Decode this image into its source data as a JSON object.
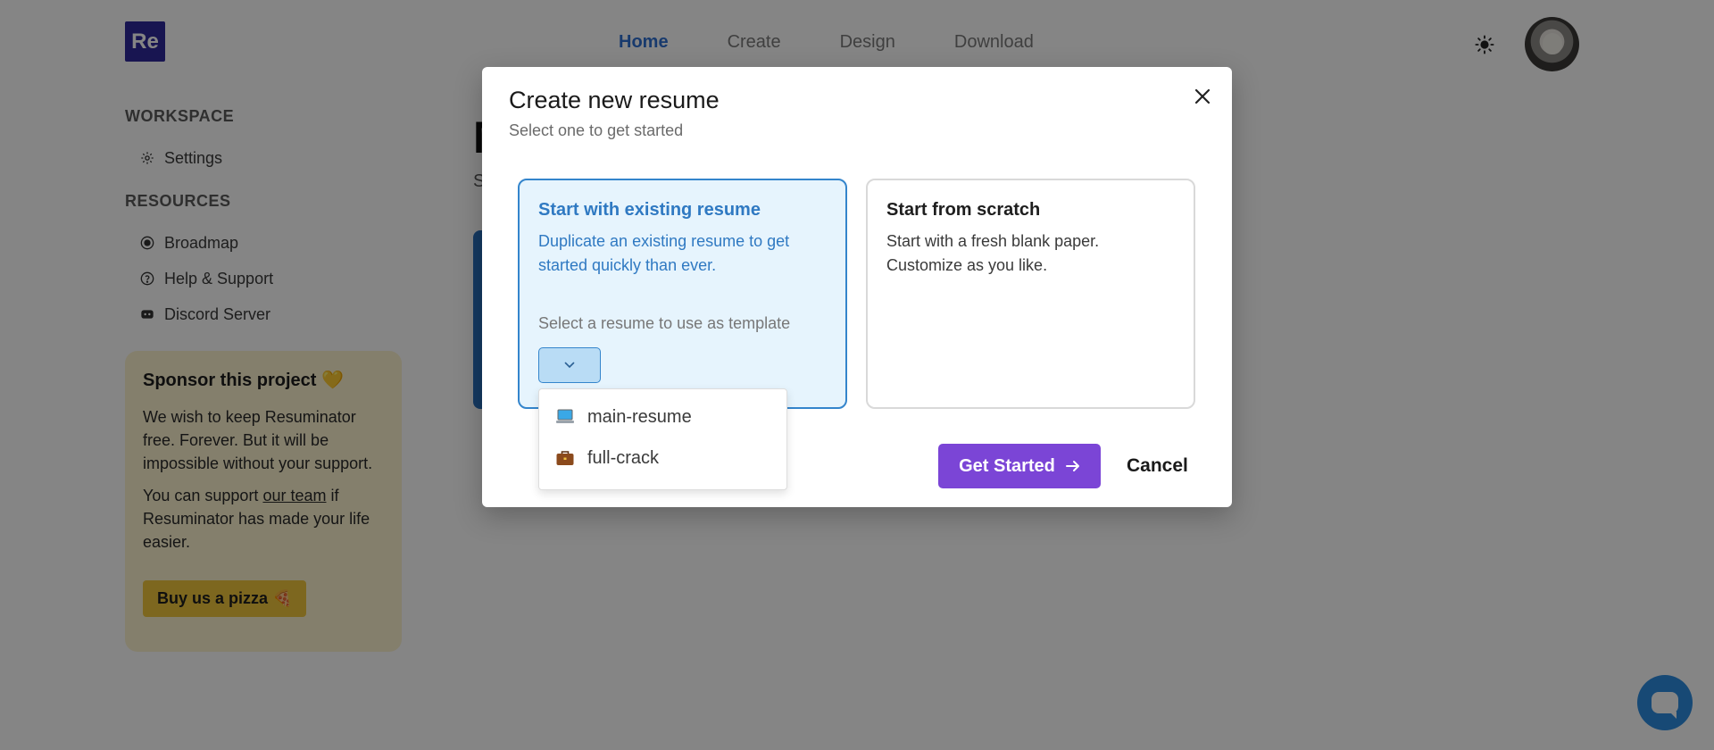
{
  "header": {
    "logo_text": "Re",
    "nav": [
      {
        "label": "Home",
        "active": true
      },
      {
        "label": "Create",
        "active": false
      },
      {
        "label": "Design",
        "active": false
      },
      {
        "label": "Download",
        "active": false
      }
    ],
    "theme_icon": "sun-icon",
    "avatar_icon": "cat-avatar"
  },
  "sidebar": {
    "workspace_heading": "WORKSPACE",
    "workspace_items": [
      {
        "label": "Settings",
        "icon": "gear-icon"
      }
    ],
    "resources_heading": "RESOURCES",
    "resources_items": [
      {
        "label": "Broadmap",
        "icon": "radio-icon"
      },
      {
        "label": "Help & Support",
        "icon": "help-icon"
      },
      {
        "label": "Discord Server",
        "icon": "discord-icon"
      }
    ]
  },
  "sponsor": {
    "title": "Sponsor this project 💛",
    "paragraph1": "We wish to keep Resuminator free. Forever. But it will be impossible without your support.",
    "paragraph2_prefix": "You can support ",
    "paragraph2_link": "our team",
    "paragraph2_suffix": " if Resuminator has made your life easier.",
    "button_label": "Buy us a pizza 🍕"
  },
  "modal": {
    "title": "Create new resume",
    "subtitle": "Select one to get started",
    "option_existing": {
      "title": "Start with existing resume",
      "description": "Duplicate an existing resume to get started quickly than ever.",
      "template_label": "Select a resume to use as template"
    },
    "option_scratch": {
      "title": "Start from scratch",
      "description": "Start with a fresh blank paper. Customize as you like."
    },
    "dropdown_items": [
      {
        "label": "main-resume",
        "icon": "laptop-icon"
      },
      {
        "label": "full-crack",
        "icon": "briefcase-icon"
      }
    ],
    "get_started_label": "Get Started",
    "cancel_label": "Cancel"
  },
  "colors": {
    "brand": "#2f2a9c",
    "accent": "#7b45d6",
    "selected_blue": "#3485cc",
    "sponsor_bg": "#fdf3cf"
  }
}
